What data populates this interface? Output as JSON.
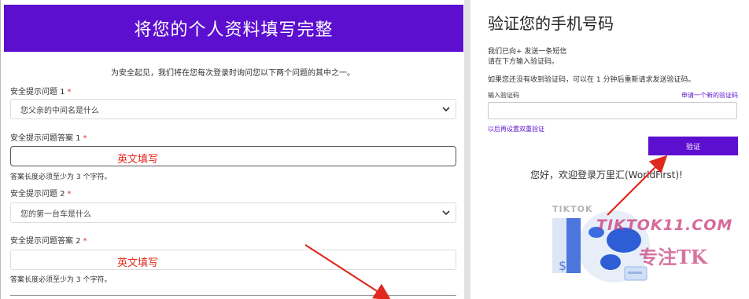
{
  "profile_form": {
    "title": "将您的个人资料填写完整",
    "intro": "为安全起见，我们将在您每次登录时询问您以下两个问题的其中之一。",
    "question1": {
      "label": "安全提示问题 1",
      "required_mark": "*",
      "selected": "您父亲的中间名是什么"
    },
    "answer1": {
      "label": "安全提示问题答案 1",
      "required_mark": "*",
      "annotation": "英文填写",
      "hint": "答案长度必须至少为 3 个字符。"
    },
    "question2": {
      "label": "安全提示问题 2",
      "required_mark": "*",
      "selected": "您的第一台车是什么"
    },
    "answer2": {
      "label": "安全提示问题答案 2",
      "required_mark": "*",
      "annotation": "英文填写",
      "hint": "答案长度必须至少为 3 个字符。"
    }
  },
  "verify_panel": {
    "title": "验证您的手机号码",
    "sent_line": "我们已向+                          发送一条短信",
    "enter_line": "请在下方输入验证码。",
    "resend_info": "如果您还没有收到验证码，可以在 1 分钟后重新请求发送验证码。",
    "code_label": "输入验证码",
    "request_new_link": "申请一个新的验证码",
    "later_setup_link": "以后再设置双重验证",
    "verify_button": "验证",
    "welcome": "您好，欢迎登录万里汇(WorldFirst)!"
  },
  "watermark": {
    "brand": "TIKTOK",
    "site": "TIKTOK11.COM",
    "slogan": "专注TK"
  },
  "colors": {
    "brand_purple": "#5c0fcf",
    "annotation_red": "#e0281e",
    "watermark_pink": "#c83778"
  },
  "icons": {
    "select_arrow": "chevron-down-icon",
    "illustration": "globe-illustration"
  }
}
